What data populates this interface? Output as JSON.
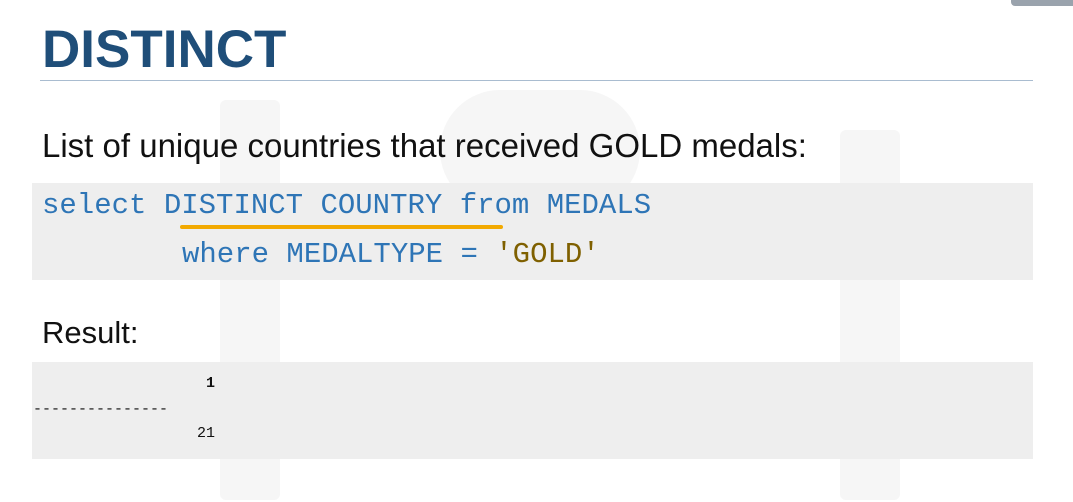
{
  "slide": {
    "title": "DISTINCT",
    "subtitle": "List of unique countries that received GOLD medals:",
    "result_label": "Result:"
  },
  "sql": {
    "select_kw": "select",
    "distinct_clause": "DISTINCT COUNTRY",
    "from_clause": "from MEDALS",
    "where_kw": "where",
    "where_col": "MEDALTYPE",
    "operator": "=",
    "where_value": "'GOLD'"
  },
  "result": {
    "column_header": "1",
    "separator": "---------------",
    "value": "21"
  },
  "colors": {
    "title": "#1f4e79",
    "code": "#2e75b6",
    "string_literal": "#7f6000",
    "highlight_underline": "#f2a900",
    "panel_bg": "#eeeeee"
  }
}
